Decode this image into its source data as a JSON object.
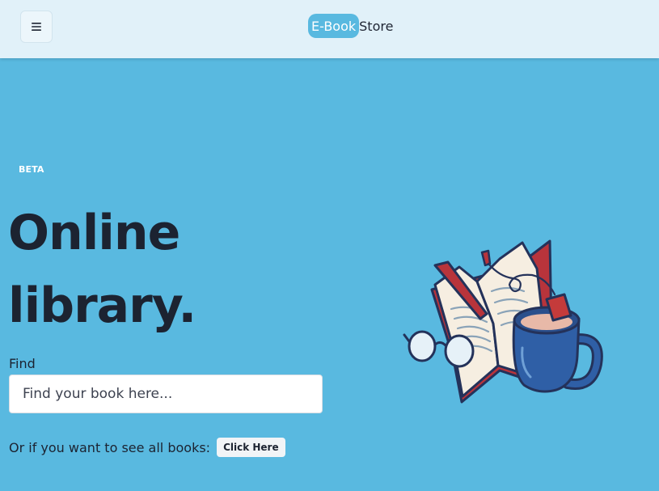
{
  "header": {
    "brand_badge": "E-Book",
    "brand_rest": "Store",
    "menu_icon": "hamburger-menu-icon"
  },
  "hero": {
    "badge": "BETA",
    "title_line1": "Online",
    "title_line2": "library.",
    "find_label": "Find",
    "search_placeholder": "Find your book here...",
    "all_books_text": "Or if you want to see all books:",
    "click_here_label": "Click Here"
  },
  "illustration": {
    "icon": "open-book-with-mug-and-glasses-illustration"
  },
  "colors": {
    "page_background": "#59b9e0",
    "header_background": "#e1f1f9",
    "accent": "#59b9e0",
    "title_text": "#1c2331"
  }
}
